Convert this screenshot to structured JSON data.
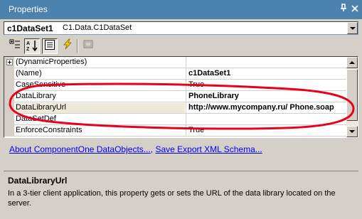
{
  "window": {
    "title": "Properties",
    "pin_glyph": "↕",
    "close_glyph": "×"
  },
  "object_selector": {
    "name": "c1DataSet1",
    "type": "C1.Data.C1DataSet"
  },
  "toolbar": {
    "categorized_icon": "categorized-icon",
    "alphabetical_icon": "alphabetical-icon",
    "properties_icon": "properties-icon",
    "events_icon": "events-icon",
    "property_pages_icon": "property-pages-icon"
  },
  "grid": {
    "rows": [
      {
        "name": "(DynamicProperties)",
        "value": "",
        "bold": false,
        "expandable": true
      },
      {
        "name": "(Name)",
        "value": "c1DataSet1",
        "bold": true,
        "expandable": false
      },
      {
        "name": "CaseSensitive",
        "value": "True",
        "bold": false,
        "expandable": false
      },
      {
        "name": "DataLibrary",
        "value": "PhoneLibrary",
        "bold": true,
        "expandable": false
      },
      {
        "name": "DataLibraryUrl",
        "value": "http://www.mycompany.ru/ Phone.soap",
        "bold": true,
        "expandable": false
      },
      {
        "name": "DataSetDef",
        "value": "",
        "bold": false,
        "expandable": false
      },
      {
        "name": "EnforceConstraints",
        "value": "True",
        "bold": false,
        "expandable": false
      }
    ]
  },
  "commands": {
    "link1": "About ComponentOne DataObjects...",
    "separator": ",",
    "link2": "Save Export XML Schema..."
  },
  "description": {
    "title": "DataLibraryUrl",
    "text": "In a 3-tier client application, this property gets or sets the URL of the data library located on the server."
  },
  "colors": {
    "titlebar": "#4b82ae",
    "annotation": "#e8001c",
    "link": "#0000ff"
  }
}
